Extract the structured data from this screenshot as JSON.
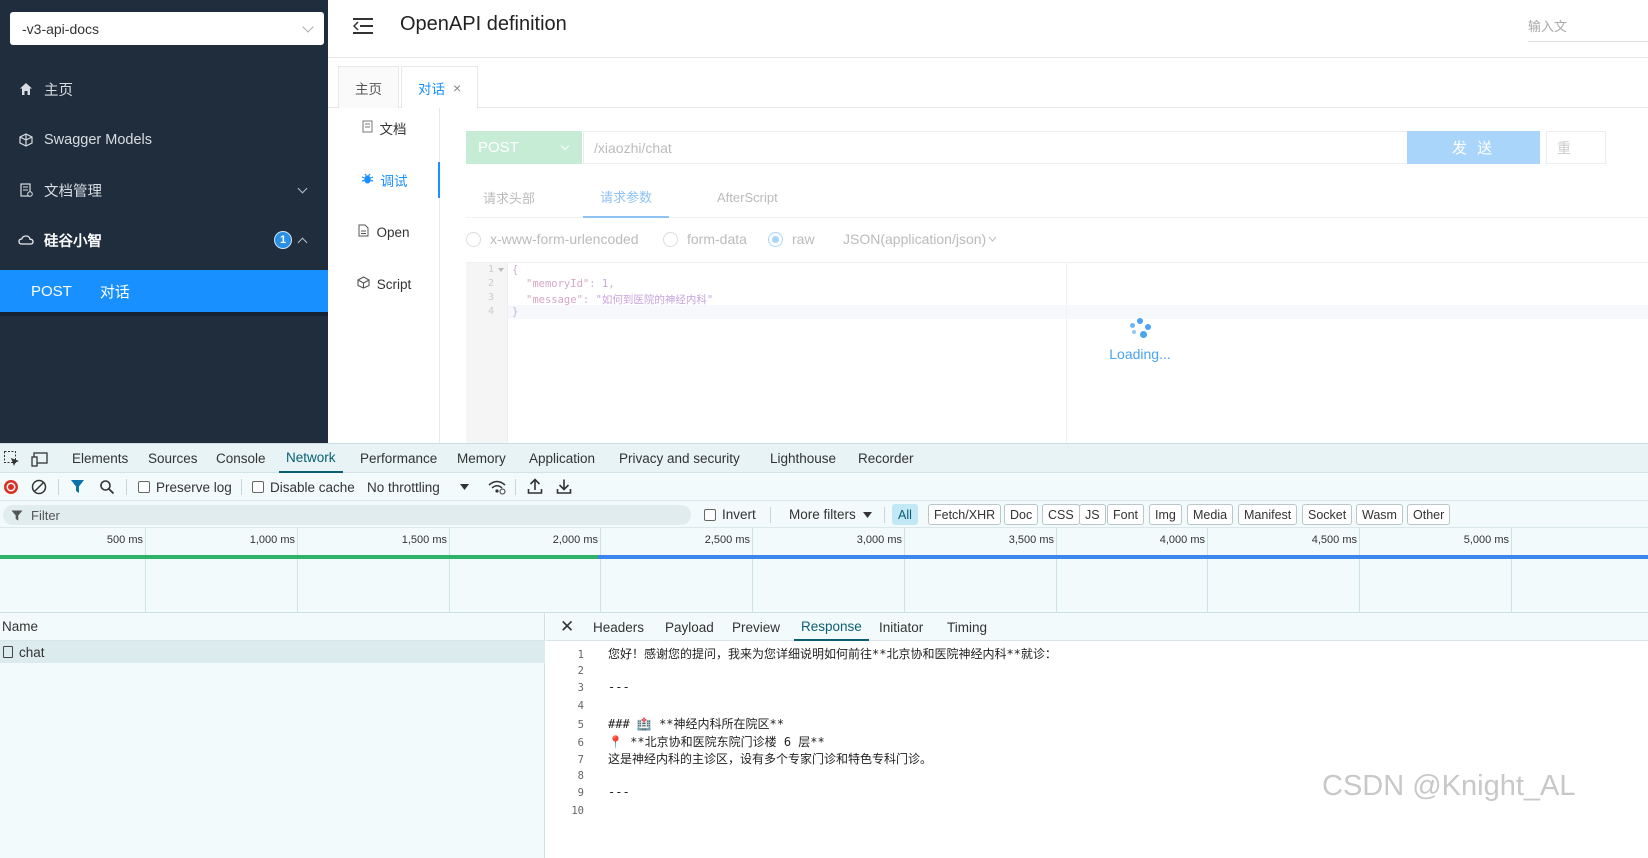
{
  "sidebar": {
    "api_select": "-v3-api-docs",
    "items": [
      {
        "label": "主页",
        "icon": "home-icon"
      },
      {
        "label": "Swagger Models",
        "icon": "cube-icon"
      },
      {
        "label": "文档管理",
        "icon": "doc-manage-icon"
      },
      {
        "label": "硅谷小智",
        "icon": "cloud-icon",
        "badge": "1"
      }
    ],
    "active_sub": {
      "method": "POST",
      "label": "对话"
    }
  },
  "header": {
    "title": "OpenAPI definition",
    "search_placeholder": "输入文"
  },
  "tabs": [
    {
      "label": "主页"
    },
    {
      "label": "对话",
      "close": "×"
    }
  ],
  "doc_tabs": [
    {
      "label": "文档",
      "icon": "doc-icon"
    },
    {
      "label": "调试",
      "icon": "bug-icon"
    },
    {
      "label": "Open",
      "icon": "file-icon"
    },
    {
      "label": "Script",
      "icon": "script-icon"
    }
  ],
  "request": {
    "method": "POST",
    "url": "/xiaozhi/chat",
    "send_label": "发 送",
    "reset_label": "重"
  },
  "request_tabs": [
    "请求头部",
    "请求参数",
    "AfterScript"
  ],
  "content_types": [
    "x-www-form-urlencoded",
    "form-data",
    "raw"
  ],
  "raw_type": "JSON(application/json)",
  "editor": {
    "line_numbers": [
      "1",
      "2",
      "3",
      "4"
    ],
    "lines": {
      "l1": "{",
      "k2": "\"memoryId\"",
      "c2": ": ",
      "v2": "1",
      "e2": ",",
      "k3": "\"message\"",
      "c3": ": ",
      "v3": "\"如何到医院的神经内科\"",
      "l4": "}"
    }
  },
  "loading_text": "Loading...",
  "devtools": {
    "tabs": [
      "Elements",
      "Sources",
      "Console",
      "Network",
      "Performance",
      "Memory",
      "Application",
      "Privacy and security",
      "Lighthouse",
      "Recorder"
    ],
    "toolbar": {
      "preserve_log": "Preserve log",
      "disable_cache": "Disable cache",
      "throttling": "No throttling"
    },
    "filter_placeholder": "Filter",
    "invert": "Invert",
    "more_filters": "More filters",
    "chips": [
      "All",
      "Fetch/XHR",
      "Doc",
      "CSS",
      "JS",
      "Font",
      "Img",
      "Media",
      "Manifest",
      "Socket",
      "Wasm",
      "Other"
    ],
    "ticks": [
      "500 ms",
      "1,000 ms",
      "1,500 ms",
      "2,000 ms",
      "2,500 ms",
      "3,000 ms",
      "3,500 ms",
      "4,000 ms",
      "4,500 ms",
      "5,000 ms"
    ],
    "name_header": "Name",
    "request_name": "chat",
    "detail_tabs": [
      "Headers",
      "Payload",
      "Preview",
      "Response",
      "Initiator",
      "Timing"
    ],
    "response_lines": [
      {
        "n": "1",
        "t": "您好！感谢您的提问，我来为您详细说明如何前往**北京协和医院神经内科**就诊："
      },
      {
        "n": "2",
        "t": ""
      },
      {
        "n": "3",
        "t": "---"
      },
      {
        "n": "4",
        "t": ""
      },
      {
        "n": "5",
        "t": "### 🏥 **神经内科所在院区**"
      },
      {
        "n": "6",
        "t": "📍 **北京协和医院东院门诊楼 6 层**"
      },
      {
        "n": "7",
        "t": "这是神经内科的主诊区，设有多个专家门诊和特色专科门诊。"
      },
      {
        "n": "8",
        "t": ""
      },
      {
        "n": "9",
        "t": "---"
      },
      {
        "n": "10",
        "t": ""
      }
    ]
  },
  "watermark": "CSDN @Knight_AL",
  "colors": {
    "sidebar_bg": "#1f2d3d",
    "accent": "#1890ff",
    "post_green": "#c7ecd6",
    "devtools_accent": "#0b5f73"
  }
}
